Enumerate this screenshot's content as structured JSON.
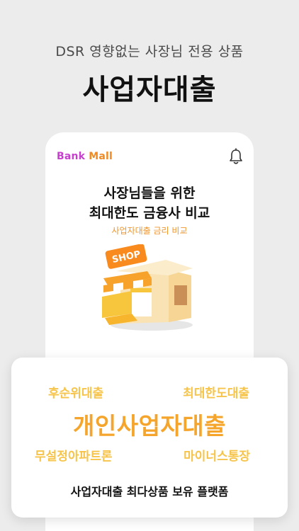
{
  "promo": {
    "subtitle": "DSR 영향없는 사장님 전용 상품",
    "title": "사업자대출"
  },
  "app": {
    "brand_part1": "Bank ",
    "brand_part2": "Mall",
    "headline_line1": "사장님들을 위한",
    "headline_line2": "최대한도 금융사 비교",
    "subline": "사업자대출 금리 비교",
    "shop_sign": "SHOP"
  },
  "card": {
    "keyword_top_left": "후순위대출",
    "keyword_top_right": "최대한도대출",
    "keyword_main": "개인사업자대출",
    "keyword_bottom_left": "무설정아파트론",
    "keyword_bottom_right": "마이너스통장",
    "footer": "사업자대출 최다상품 보유 플랫폼"
  },
  "colors": {
    "background": "#ececec",
    "brand_purple": "#c83fd0",
    "brand_orange": "#f08a22",
    "accent_orange": "#f5a52b",
    "keyword_yellow": "#f6c44a"
  },
  "icons": {
    "notification": "bell-icon",
    "illustration": "shop-store-icon"
  }
}
